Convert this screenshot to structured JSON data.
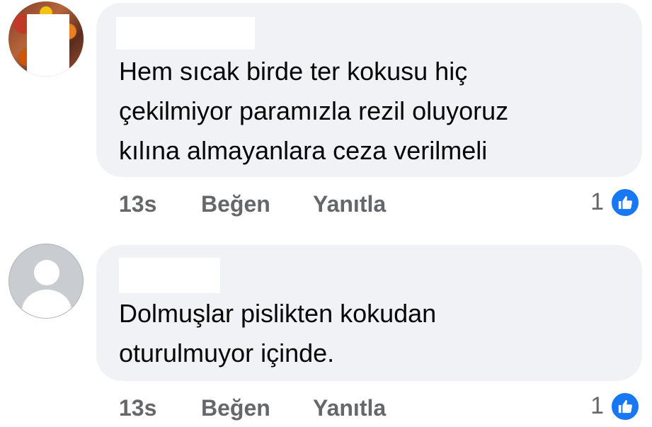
{
  "comments": [
    {
      "avatar": "profile-photo",
      "text_lines": [
        "Hem sıcak birde ter kokusu hiç",
        "çekilmiyor paramızla rezil oluyoruz",
        "kılına almayanlara ceza verilmeli"
      ],
      "time": "13s",
      "like_label": "Beğen",
      "reply_label": "Yanıtla",
      "reaction_count": "1",
      "reaction_icon": "like-thumb-icon"
    },
    {
      "avatar": "default-avatar",
      "text_lines": [
        "Dolmuşlar pislikten kokudan",
        "oturulmuyor içinde."
      ],
      "time": "13s",
      "like_label": "Beğen",
      "reply_label": "Yanıtla",
      "reaction_count": "1",
      "reaction_icon": "like-thumb-icon"
    }
  ],
  "colors": {
    "bubble": "#f0f2f5",
    "meta_text": "#65676b",
    "like_blue": "#1877f2"
  }
}
